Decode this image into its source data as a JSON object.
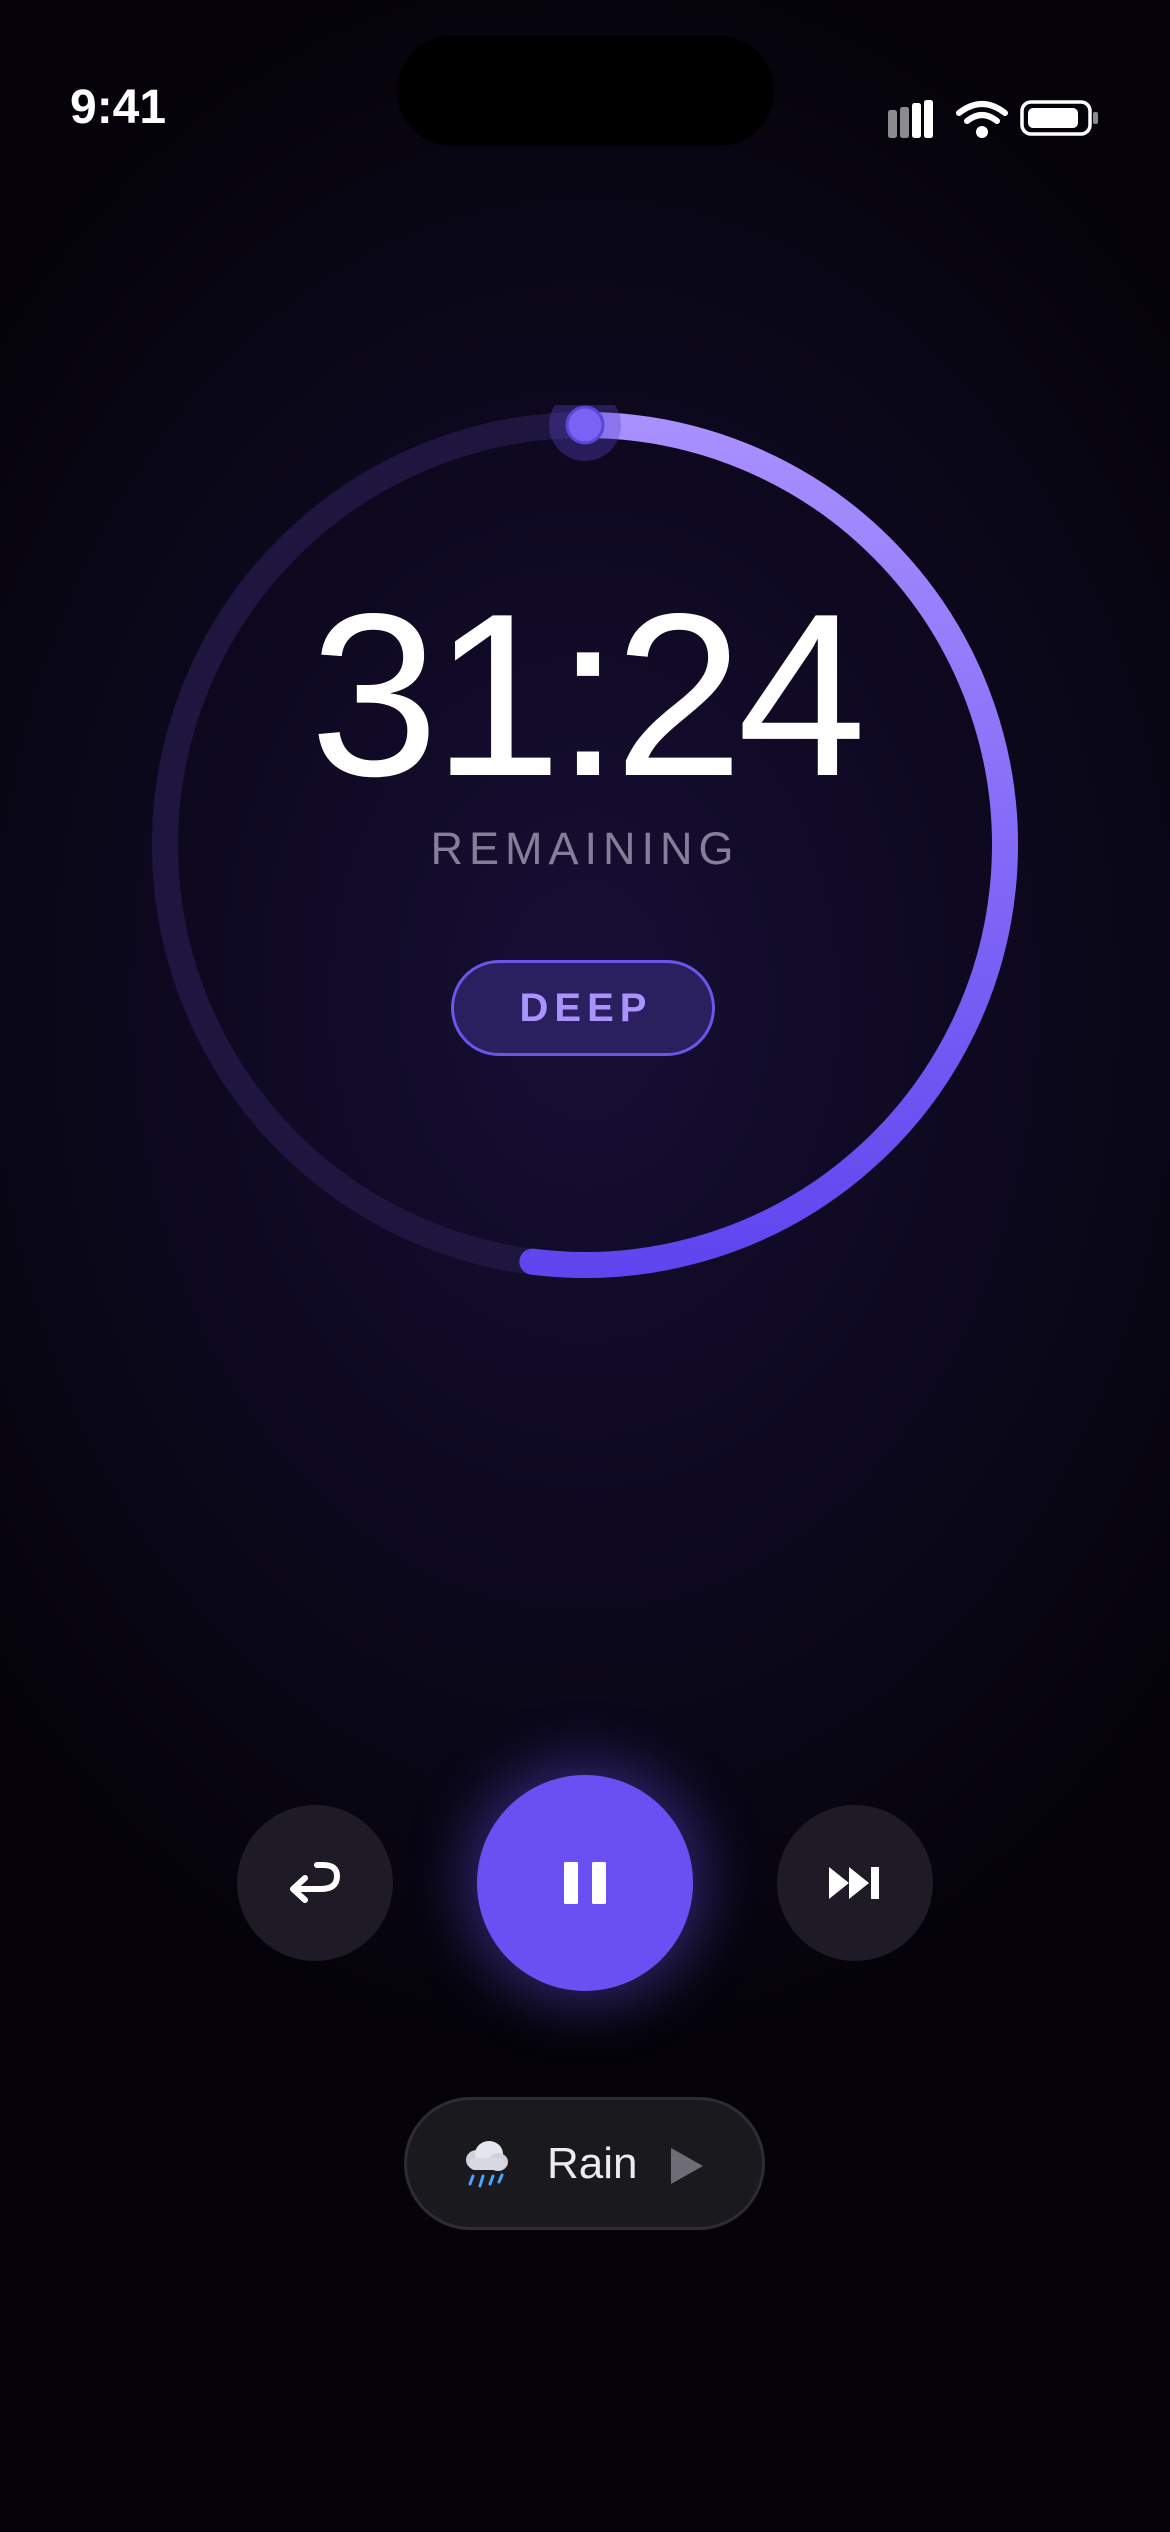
{
  "status_bar": {
    "time": "9:41",
    "icons": [
      "signal-icon",
      "wifi-icon",
      "battery-icon"
    ]
  },
  "timer": {
    "time_remaining": "31:24",
    "remaining_label": "REMAINING",
    "mode": "DEEP",
    "progress_fraction": 0.52
  },
  "controls": {
    "reset_icon": "return-icon",
    "pause_icon": "pause-icon",
    "skip_icon": "skip-forward-icon"
  },
  "ambient_sound": {
    "icon": "rain-cloud-icon",
    "label": "Rain",
    "play_icon": "play-icon"
  },
  "colors": {
    "accent": "#6a50f2",
    "accent_light": "#a994ff",
    "background": "#07050f"
  }
}
